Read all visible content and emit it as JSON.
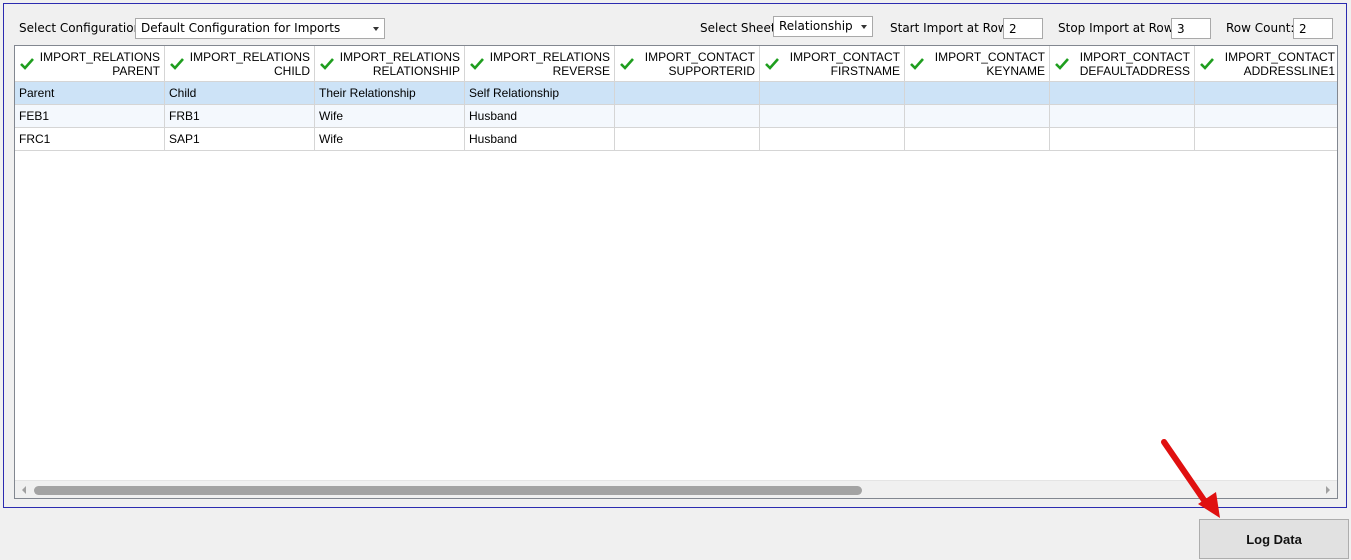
{
  "toolbar": {
    "config_label": "Select Configuration",
    "config_value": "Default Configuration for Imports",
    "sheet_label": "Select Sheet",
    "sheet_value": "Relationship",
    "start_label": "Start Import at Row:",
    "start_value": "2",
    "stop_label": "Stop Import at Row:",
    "stop_value": "3",
    "count_label": "Row Count:",
    "count_value": "2"
  },
  "grid": {
    "columns": [
      {
        "line1": "IMPORT_RELATIONS",
        "line2": "PARENT"
      },
      {
        "line1": "IMPORT_RELATIONS",
        "line2": "CHILD"
      },
      {
        "line1": "IMPORT_RELATIONS",
        "line2": "RELATIONSHIP"
      },
      {
        "line1": "IMPORT_RELATIONS",
        "line2": "REVERSE"
      },
      {
        "line1": "IMPORT_CONTACT",
        "line2": "SUPPORTERID"
      },
      {
        "line1": "IMPORT_CONTACT",
        "line2": "FIRSTNAME"
      },
      {
        "line1": "IMPORT_CONTACT",
        "line2": "KEYNAME"
      },
      {
        "line1": "IMPORT_CONTACT",
        "line2": "DEFAULTADDRESS"
      },
      {
        "line1": "IMPORT_CONTACT",
        "line2": "ADDRESSLINE1"
      }
    ],
    "rows": [
      [
        "Parent",
        "Child",
        "Their Relationship",
        "Self Relationship",
        "",
        "",
        "",
        "",
        ""
      ],
      [
        "FEB1",
        "FRB1",
        "Wife",
        "Husband",
        "",
        "",
        "",
        "",
        ""
      ],
      [
        "FRC1",
        "SAP1",
        "Wife",
        "Husband",
        "",
        "",
        "",
        "",
        ""
      ]
    ]
  },
  "log_button": "Log Data",
  "colors": {
    "check": "#1f9e1f",
    "selected_row": "#cde3f7",
    "panel_border": "#2b2bb0",
    "arrow": "#e01010"
  },
  "icons": {
    "header": "check-icon",
    "scroll_left": "arrow-left-icon",
    "scroll_right": "arrow-right-icon",
    "annotation": "red-arrow-icon"
  }
}
